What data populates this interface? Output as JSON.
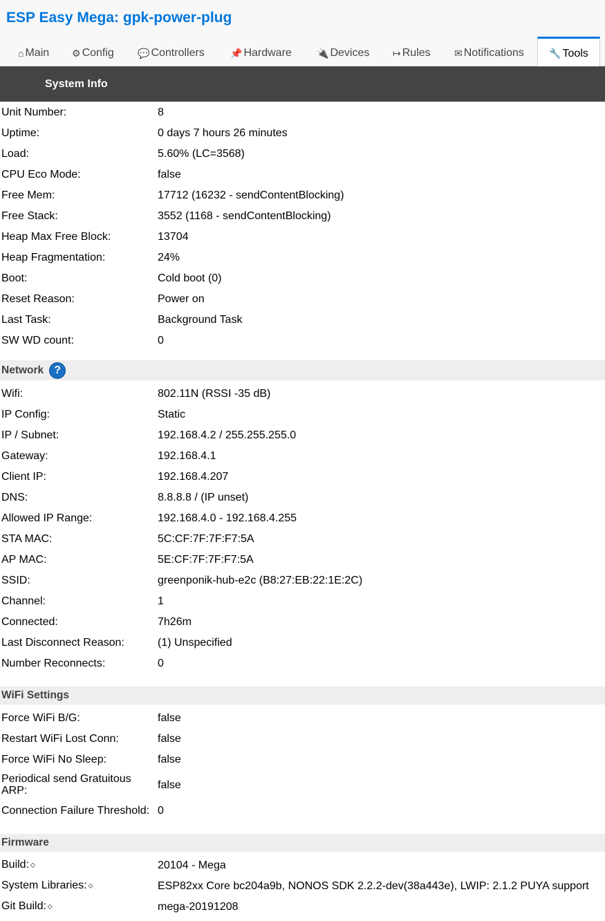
{
  "app_title": "ESP Easy Mega: gpk-power-plug",
  "tabs": [
    {
      "icon": "⌂",
      "label": "Main"
    },
    {
      "icon": "⚙",
      "label": "Config"
    },
    {
      "icon": "💬",
      "label": "Controllers"
    },
    {
      "icon": "📌",
      "label": "Hardware"
    },
    {
      "icon": "🔌",
      "label": "Devices"
    },
    {
      "icon": "↦",
      "label": "Rules"
    },
    {
      "icon": "✉",
      "label": "Notifications"
    },
    {
      "icon": "🔧",
      "label": "Tools"
    }
  ],
  "system_info": {
    "title": "System Info",
    "rows": [
      {
        "label": "Unit Number:",
        "value": "8"
      },
      {
        "label": "Uptime:",
        "value": "0 days 7 hours 26 minutes"
      },
      {
        "label": "Load:",
        "value": "5.60% (LC=3568)"
      },
      {
        "label": "CPU Eco Mode:",
        "value": "false"
      },
      {
        "label": "Free Mem:",
        "value": "17712 (16232 - sendContentBlocking)"
      },
      {
        "label": "Free Stack:",
        "value": "3552 (1168 - sendContentBlocking)"
      },
      {
        "label": "Heap Max Free Block:",
        "value": "13704"
      },
      {
        "label": "Heap Fragmentation:",
        "value": "24%"
      },
      {
        "label": "Boot:",
        "value": "Cold boot (0)"
      },
      {
        "label": "Reset Reason:",
        "value": "Power on"
      },
      {
        "label": "Last Task:",
        "value": "Background Task"
      },
      {
        "label": "SW WD count:",
        "value": "0"
      }
    ]
  },
  "network": {
    "title": "Network",
    "help_icon": "?",
    "rows": [
      {
        "label": "Wifi:",
        "value": "802.11N (RSSI -35 dB)"
      },
      {
        "label": "IP Config:",
        "value": "Static"
      },
      {
        "label": "IP / Subnet:",
        "value": "192.168.4.2 / 255.255.255.0"
      },
      {
        "label": "Gateway:",
        "value": "192.168.4.1"
      },
      {
        "label": "Client IP:",
        "value": "192.168.4.207"
      },
      {
        "label": "DNS:",
        "value": "8.8.8.8 / (IP unset)"
      },
      {
        "label": "Allowed IP Range:",
        "value": "192.168.4.0 - 192.168.4.255"
      },
      {
        "label": "STA MAC:",
        "value": "5C:CF:7F:7F:F7:5A"
      },
      {
        "label": "AP MAC:",
        "value": "5E:CF:7F:7F:F7:5A"
      },
      {
        "label": "SSID:",
        "value": "greenponik-hub-e2c (B8:27:EB:22:1E:2C)"
      },
      {
        "label": "Channel:",
        "value": "1"
      },
      {
        "label": "Connected:",
        "value": "7h26m"
      },
      {
        "label": "Last Disconnect Reason:",
        "value": "(1) Unspecified"
      },
      {
        "label": "Number Reconnects:",
        "value": "0"
      }
    ]
  },
  "wifi_settings": {
    "title": "WiFi Settings",
    "rows": [
      {
        "label": "Force WiFi B/G:",
        "value": "false"
      },
      {
        "label": "Restart WiFi Lost Conn:",
        "value": "false"
      },
      {
        "label": "Force WiFi No Sleep:",
        "value": "false"
      },
      {
        "label": "Periodical send Gratuitous ARP:",
        "value": "false"
      },
      {
        "label": "Connection Failure Threshold:",
        "value": "0"
      }
    ]
  },
  "firmware": {
    "title": "Firmware",
    "copy_icon": "⬦",
    "rows": [
      {
        "label": "Build:",
        "value": "20104 - Mega"
      },
      {
        "label": "System Libraries:",
        "value": "ESP82xx Core bc204a9b, NONOS SDK 2.2.2-dev(38a443e), LWIP: 2.1.2 PUYA support"
      },
      {
        "label": "Git Build:",
        "value": "mega-20191208"
      }
    ]
  }
}
